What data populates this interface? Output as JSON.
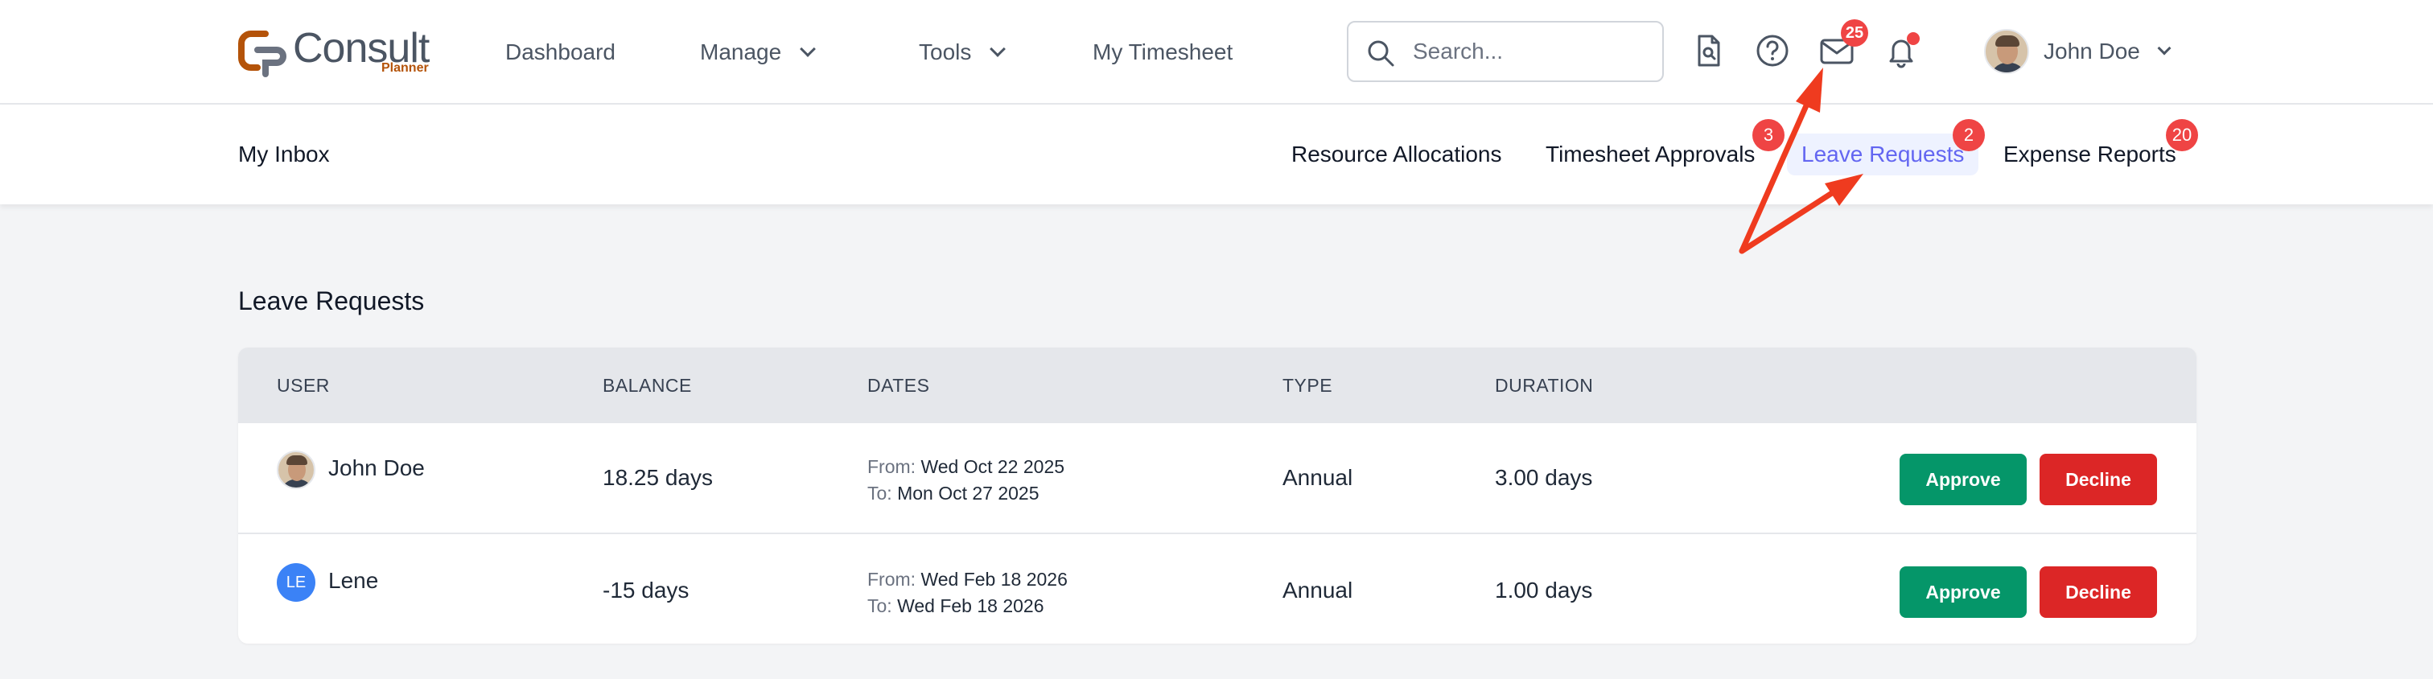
{
  "app": {
    "logo_text": "Consult",
    "logo_sub": "Planner",
    "nav": {
      "dashboard": "Dashboard",
      "manage": "Manage",
      "tools": "Tools",
      "my_timesheet": "My Timesheet"
    },
    "search": {
      "placeholder": "Search..."
    },
    "icons": {
      "doc_search": "doc-search-icon",
      "help": "help-icon",
      "mail": "mail-icon",
      "bell": "bell-icon"
    },
    "mail_badge": "25",
    "user": {
      "name": "John Doe"
    }
  },
  "subnav": {
    "title": "My Inbox",
    "tabs": [
      {
        "label": "Resource Allocations",
        "badge": ""
      },
      {
        "label": "Timesheet Approvals",
        "badge": "3"
      },
      {
        "label": "Leave Requests",
        "badge": "2"
      },
      {
        "label": "Expense Reports",
        "badge": "20"
      }
    ]
  },
  "main": {
    "section_title": "Leave Requests",
    "columns": [
      "USER",
      "BALANCE",
      "DATES",
      "TYPE",
      "DURATION"
    ],
    "from_label": "From:",
    "to_label": "To:",
    "approve_label": "Approve",
    "decline_label": "Decline",
    "rows": [
      {
        "user": "John Doe",
        "initials": "",
        "balance": "18.25 days",
        "from": "Wed Oct 22 2025",
        "to": "Mon Oct 27 2025",
        "type": "Annual",
        "duration": "3.00 days"
      },
      {
        "user": "Lene",
        "initials": "LE",
        "balance": "-15 days",
        "from": "Wed Feb 18 2026",
        "to": "Wed Feb 18 2026",
        "type": "Annual",
        "duration": "1.00 days"
      }
    ]
  },
  "colors": {
    "accent": "#6366f1",
    "badge": "#ef4444",
    "approve": "#059669",
    "decline": "#dc2626",
    "annotation_arrow": "#ef3b1f"
  }
}
